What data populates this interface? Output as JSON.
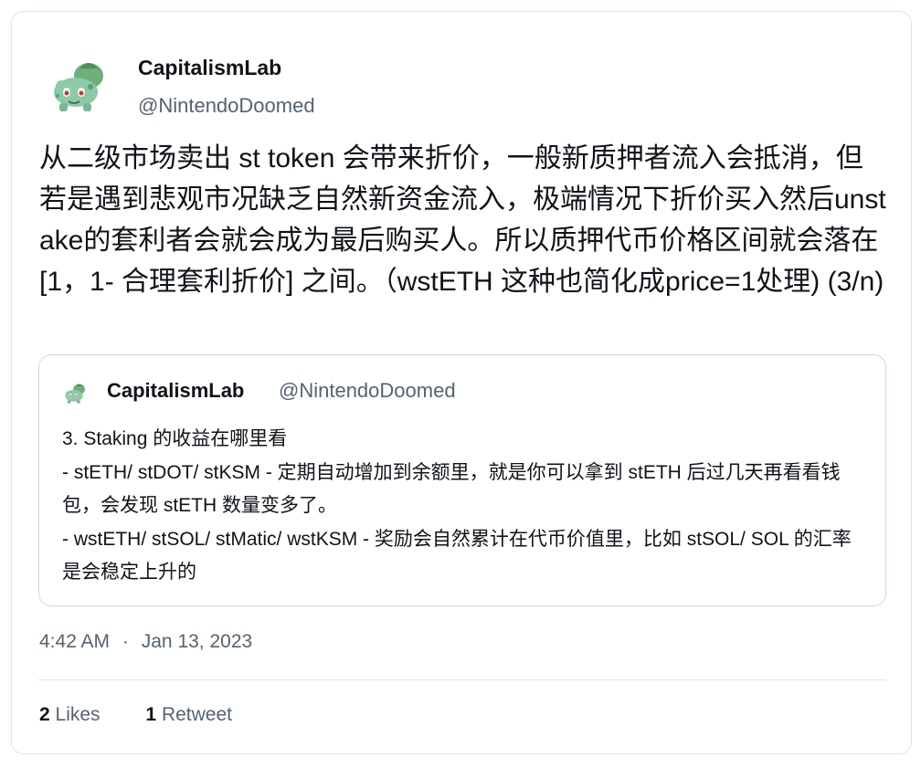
{
  "tweet": {
    "author_name": "CapitalismLab",
    "author_handle": "@NintendoDoomed",
    "text": "从二级市场卖出 st token 会带来折价，一般新质押者流入会抵消，但若是遇到悲观市况缺乏自然新资金流入，极端情况下折价买入然后unstake的套利者会就会成为最后购买人。所以质押代币价格区间就会落在 [1，1- 合理套利折价] 之间。（wstETH 这种也简化成price=1处理) (3/n)",
    "timestamp": "4:42 AM",
    "separator": "·",
    "date": "Jan 13, 2023"
  },
  "quoted_tweet": {
    "author_name": "CapitalismLab",
    "author_handle": "@NintendoDoomed",
    "text": "3. Staking 的收益在哪里看\n- stETH/ stDOT/ stKSM - 定期自动增加到余额里，就是你可以拿到 stETH 后过几天再看看钱包，会发现 stETH 数量变多了。\n- wstETH/ stSOL/ stMatic/ wstKSM - 奖励会自然累计在代币价值里，比如 stSOL/ SOL 的汇率是会稳定上升的"
  },
  "stats": {
    "likes_count": "2",
    "likes_label": "Likes",
    "retweets_count": "1",
    "retweets_label": "Retweet"
  },
  "icons": {
    "avatar": "bulbasaur-avatar-icon"
  },
  "colors": {
    "text_primary": "#0f1419",
    "text_secondary": "#536471",
    "border": "#dfe3e6",
    "avatar_green": "#8cc9a8"
  }
}
